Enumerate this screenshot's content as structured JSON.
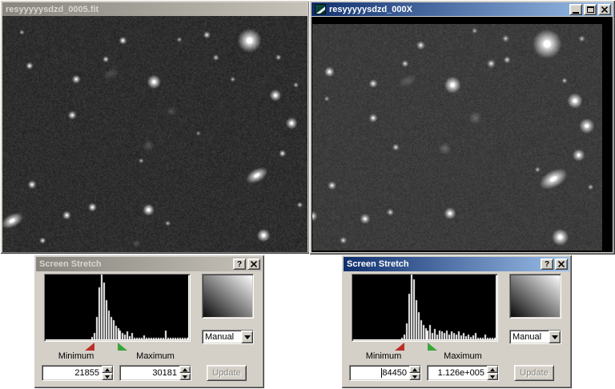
{
  "windows": {
    "left_image": {
      "title": "resyyyyysdzd_0005.fit",
      "state": "inactive",
      "background": "#2e2e2e",
      "stars": [
        [
          0.81,
          0.104,
          6.5,
          1.0,
          "s"
        ],
        [
          0.395,
          0.104,
          2.2,
          0.8,
          "s"
        ],
        [
          0.67,
          0.08,
          2.0,
          0.7,
          "s"
        ],
        [
          0.7,
          0.176,
          1.8,
          0.55,
          "s"
        ],
        [
          0.089,
          0.211,
          2.0,
          0.8,
          "s"
        ],
        [
          0.242,
          0.268,
          2.4,
          0.8,
          "s"
        ],
        [
          0.497,
          0.279,
          3.8,
          0.95,
          "s"
        ],
        [
          0.895,
          0.336,
          3.2,
          0.9,
          "s"
        ],
        [
          0.948,
          0.454,
          3.2,
          0.9,
          "s"
        ],
        [
          0.229,
          0.42,
          2.4,
          0.8,
          "s"
        ],
        [
          0.918,
          0.582,
          2.0,
          0.7,
          "s"
        ],
        [
          0.834,
          0.675,
          3.6,
          0.9,
          "e"
        ],
        [
          0.097,
          0.714,
          2.4,
          0.8,
          "s"
        ],
        [
          0.295,
          0.81,
          2.4,
          0.85,
          "s"
        ],
        [
          0.479,
          0.821,
          3.2,
          0.95,
          "s"
        ],
        [
          0.211,
          0.844,
          2.4,
          0.8,
          "s"
        ],
        [
          0.032,
          0.867,
          3.6,
          0.9,
          "e"
        ],
        [
          0.856,
          0.929,
          3.6,
          0.95,
          "s"
        ],
        [
          0.132,
          0.951,
          1.8,
          0.7,
          "s"
        ],
        [
          0.339,
          0.183,
          1.8,
          0.7,
          "s"
        ],
        [
          0.755,
          0.268,
          1.5,
          0.5,
          "s"
        ],
        [
          0.479,
          0.549,
          3.0,
          0.45,
          "f"
        ],
        [
          0.553,
          0.403,
          2.6,
          0.35,
          "f"
        ],
        [
          0.356,
          0.244,
          2.6,
          0.35,
          "fe"
        ],
        [
          0.439,
          0.963,
          2.2,
          0.4,
          "f"
        ],
        [
          0.064,
          0.069,
          1.5,
          0.5,
          "s"
        ],
        [
          0.58,
          0.1,
          1.5,
          0.5,
          "s"
        ],
        [
          0.905,
          0.175,
          1.6,
          0.6,
          "s"
        ],
        [
          0.455,
          0.613,
          1.5,
          0.5,
          "s"
        ],
        [
          0.975,
          0.8,
          1.6,
          0.6,
          "s"
        ],
        [
          0.642,
          0.497,
          1.4,
          0.4,
          "s"
        ],
        [
          0.542,
          0.878,
          1.6,
          0.5,
          "s"
        ],
        [
          0.962,
          0.292,
          1.5,
          0.55,
          "s"
        ]
      ]
    },
    "right_image": {
      "title": "resyyyyysdzd_000X",
      "state": "active",
      "background": "#3c3c3c",
      "window_buttons": [
        "minimize",
        "maximize",
        "close"
      ],
      "stars": [
        [
          0.81,
          0.088,
          8.0,
          1.0,
          "s"
        ],
        [
          0.484,
          0.269,
          4.6,
          0.95,
          "s"
        ],
        [
          0.906,
          0.339,
          4.2,
          0.95,
          "s"
        ],
        [
          0.947,
          0.45,
          4.2,
          0.9,
          "s"
        ],
        [
          0.919,
          0.579,
          3.4,
          0.85,
          "s"
        ],
        [
          0.832,
          0.684,
          4.6,
          0.95,
          "e"
        ],
        [
          0.855,
          0.941,
          4.6,
          1.0,
          "s"
        ],
        [
          0.059,
          0.211,
          2.8,
          0.85,
          "s"
        ],
        [
          0.21,
          0.263,
          2.4,
          0.7,
          "s"
        ],
        [
          0.32,
          0.175,
          2.0,
          0.6,
          "s"
        ],
        [
          0.374,
          0.094,
          2.4,
          0.7,
          "s"
        ],
        [
          0.617,
          0.175,
          2.4,
          0.65,
          "s"
        ],
        [
          0.672,
          0.158,
          2.0,
          0.6,
          "s"
        ],
        [
          0.667,
          0.064,
          2.0,
          0.55,
          "s"
        ],
        [
          0.329,
          0.252,
          3.0,
          0.4,
          "fe"
        ],
        [
          0.562,
          0.415,
          3.4,
          0.5,
          "f"
        ],
        [
          0.457,
          0.55,
          3.2,
          0.55,
          "f"
        ],
        [
          0.288,
          0.544,
          2.0,
          0.6,
          "s"
        ],
        [
          0.21,
          0.415,
          2.4,
          0.75,
          "s"
        ],
        [
          0.068,
          0.713,
          2.4,
          0.7,
          "s"
        ],
        [
          0.182,
          0.86,
          2.8,
          0.8,
          "s"
        ],
        [
          0.269,
          0.831,
          2.0,
          0.6,
          "s"
        ],
        [
          0.475,
          0.836,
          3.2,
          0.9,
          "s"
        ],
        [
          0.0,
          0.848,
          2.8,
          0.8,
          "s"
        ],
        [
          0.777,
          0.643,
          1.6,
          0.5,
          "s"
        ],
        [
          0.107,
          0.955,
          2.0,
          0.6,
          "s"
        ],
        [
          0.93,
          0.065,
          1.8,
          0.5,
          "s"
        ],
        [
          0.56,
          0.03,
          1.6,
          0.5,
          "s"
        ],
        [
          0.96,
          0.72,
          1.6,
          0.5,
          "s"
        ],
        [
          0.05,
          0.33,
          1.5,
          0.45,
          "s"
        ],
        [
          0.87,
          0.25,
          1.6,
          0.55,
          "s"
        ]
      ]
    }
  },
  "dialogs": {
    "left": {
      "title": "Screen Stretch",
      "state": "inactive",
      "help_button": "?",
      "mode": "Manual",
      "minimum_label": "Minimum",
      "maximum_label": "Maximum",
      "minimum_value": "21855",
      "maximum_value": "30181",
      "update_label": "Update"
    },
    "right": {
      "title": "Screen Stretch",
      "state": "active",
      "help_button": "?",
      "mode": "Manual",
      "minimum_label": "Minimum",
      "maximum_label": "Maximum",
      "minimum_value": "84450",
      "maximum_value": "1.126e+005",
      "update_label": "Update"
    }
  },
  "colors": {
    "classic_gray": "#d4d0c8",
    "active_title_start": "#10306e",
    "active_title_end": "#9cc0ea",
    "inactive_title_start": "#87857e",
    "inactive_title_end": "#c6c2b9",
    "marker_red": "#bc2f26",
    "marker_green": "#3aa43a"
  },
  "chart_data": [
    {
      "type": "histogram",
      "window": "resyyyyysdzd_0005.fit",
      "minimum": 21855,
      "maximum": 30181,
      "ylim": [
        0,
        1
      ],
      "markers": {
        "minimum_frac": 0.34,
        "maximum_frac": 0.5
      },
      "bins": [
        0,
        0,
        0,
        0,
        0,
        0,
        0,
        0,
        0,
        0,
        0,
        0,
        0,
        0,
        0,
        0,
        0,
        0,
        0,
        0.04,
        0.1,
        0.35,
        0.8,
        1.0,
        0.88,
        0.6,
        0.44,
        0.34,
        0.3,
        0.21,
        0.17,
        0.14,
        0.1,
        0.08,
        0.12,
        0.05,
        0.1,
        0.03,
        0.03,
        0.02,
        0.02,
        0.06,
        0.02,
        0.02,
        0.02,
        0.02,
        0.02,
        0.02,
        0.02,
        0.02,
        0.13,
        0.02,
        0.02,
        0.02,
        0.02,
        0.02,
        0.02,
        0.02,
        0.02,
        0.02
      ]
    },
    {
      "type": "histogram",
      "window": "resyyyyysdzd_000X",
      "minimum": 84450,
      "maximum": 112600,
      "ylim": [
        0,
        1
      ],
      "markers": {
        "minimum_frac": 0.36,
        "maximum_frac": 0.52
      },
      "bins": [
        0,
        0,
        0,
        0,
        0,
        0,
        0,
        0,
        0,
        0,
        0,
        0,
        0,
        0,
        0,
        0,
        0,
        0,
        0,
        0,
        0.03,
        0.07,
        0.25,
        0.7,
        1.0,
        0.92,
        0.6,
        0.42,
        0.3,
        0.22,
        0.17,
        0.13,
        0.22,
        0.1,
        0.16,
        0.08,
        0.14,
        0.12,
        0.1,
        0.14,
        0.08,
        0.12,
        0.1,
        0.08,
        0.12,
        0.06,
        0.1,
        0.05,
        0.08,
        0.04,
        0.06,
        0.1,
        0.03,
        0.03,
        0.03,
        0.08,
        0.03,
        0.03,
        0.03,
        0.02
      ]
    }
  ]
}
